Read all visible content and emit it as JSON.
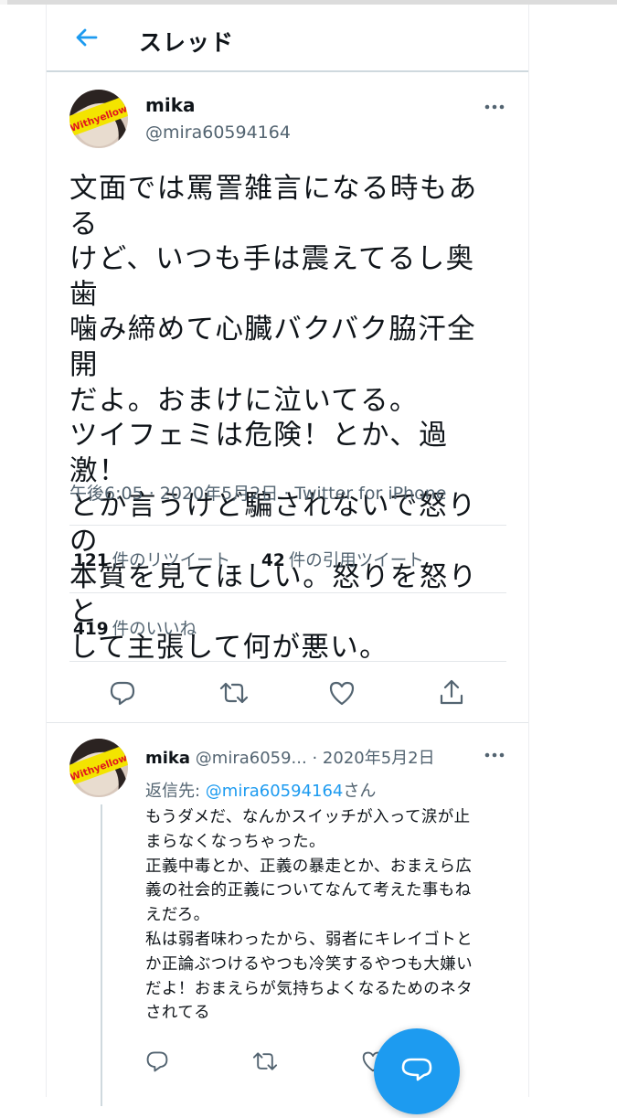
{
  "header": {
    "title": "スレッド",
    "back_icon": "arrow-left-icon"
  },
  "tweet": {
    "name": "mika",
    "handle": "@mira60594164",
    "avatar_text": "Withyellow",
    "text": "文面では罵詈雑言になる時もある\nけど、いつも手は震えてるし奥歯\n噛み締めて心臓バクバク脇汗全開\nだよ。おまけに泣いてる。\nツイフェミは危険！とか、過激！\nとか言うけど騙されないで怒りの\n本質を見てほしい。怒りを怒りと\nして主張して何が悪い。",
    "meta": "午後6:05 · 2020年5月2日 · Twitter for iPhone",
    "retweets": {
      "count": "121",
      "label": "件のリツイート"
    },
    "quotes": {
      "count": "42",
      "label": "件の引用ツイート"
    },
    "likes": {
      "count": "419",
      "label": "件のいいね"
    }
  },
  "reply": {
    "name": "mika",
    "handle": "@mira6059...",
    "date": "· 2020年5月2日",
    "reply_prefix": "返信先: ",
    "reply_to": "@mira60594164",
    "reply_suffix": "さん",
    "text": "もうダメだ、なんかスイッチが入って涙が止\nまらなくなっちゃった。\n正義中毒とか、正義の暴走とか、おまえら広\n義の社会的正義についてなんて考えた事もね\nえだろ。\n私は弱者味わったから、弱者にキレイゴトと\nか正論ぶつけるやつも冷笑するやつも大嫌い\nだよ！おまえらが気持ちよくなるためのネタ\nされてる"
  },
  "colors": {
    "accent": "#1d9bf0",
    "secondary_text": "#536471",
    "divider": "#e3e7ea"
  },
  "icons": [
    "reply-icon",
    "retweet-icon",
    "like-icon",
    "share-icon",
    "more-icon",
    "compose-icon"
  ]
}
